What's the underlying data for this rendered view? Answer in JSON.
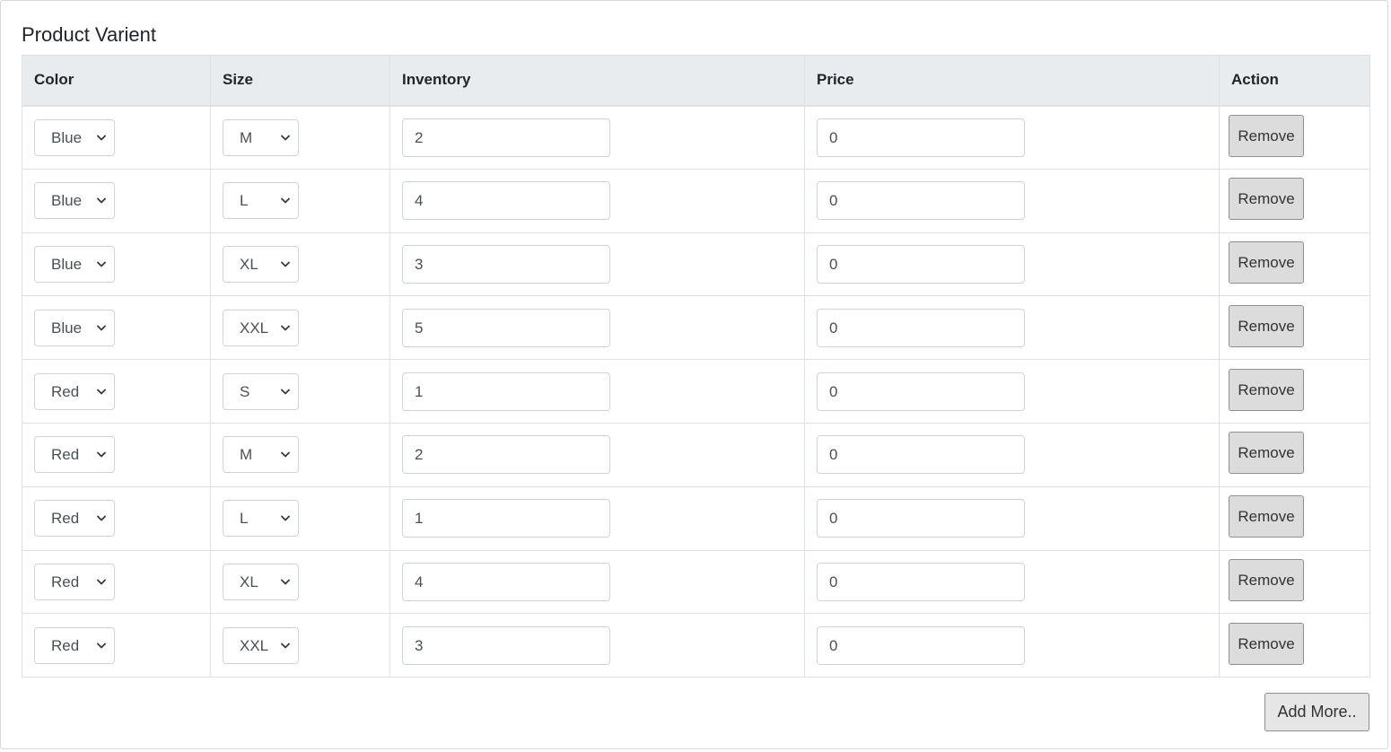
{
  "page": {
    "title": "Product Varient"
  },
  "table": {
    "headers": {
      "color": "Color",
      "size": "Size",
      "inventory": "Inventory",
      "price": "Price",
      "action": "Action"
    },
    "rows": [
      {
        "color": "Blue",
        "size": "M",
        "inventory": "2",
        "price": "0",
        "action": "Remove"
      },
      {
        "color": "Blue",
        "size": "L",
        "inventory": "4",
        "price": "0",
        "action": "Remove"
      },
      {
        "color": "Blue",
        "size": "XL",
        "inventory": "3",
        "price": "0",
        "action": "Remove"
      },
      {
        "color": "Blue",
        "size": "XXL",
        "inventory": "5",
        "price": "0",
        "action": "Remove"
      },
      {
        "color": "Red",
        "size": "S",
        "inventory": "1",
        "price": "0",
        "action": "Remove"
      },
      {
        "color": "Red",
        "size": "M",
        "inventory": "2",
        "price": "0",
        "action": "Remove"
      },
      {
        "color": "Red",
        "size": "L",
        "inventory": "1",
        "price": "0",
        "action": "Remove"
      },
      {
        "color": "Red",
        "size": "XL",
        "inventory": "4",
        "price": "0",
        "action": "Remove"
      },
      {
        "color": "Red",
        "size": "XXL",
        "inventory": "3",
        "price": "0",
        "action": "Remove"
      }
    ]
  },
  "footer": {
    "add_more_label": "Add More.."
  },
  "icons": {
    "dropdown": "chevron-down-icon"
  },
  "colors": {
    "header_bg": "#e9ecef",
    "border": "#dee2e6",
    "button_bg": "#dcdcdc"
  }
}
